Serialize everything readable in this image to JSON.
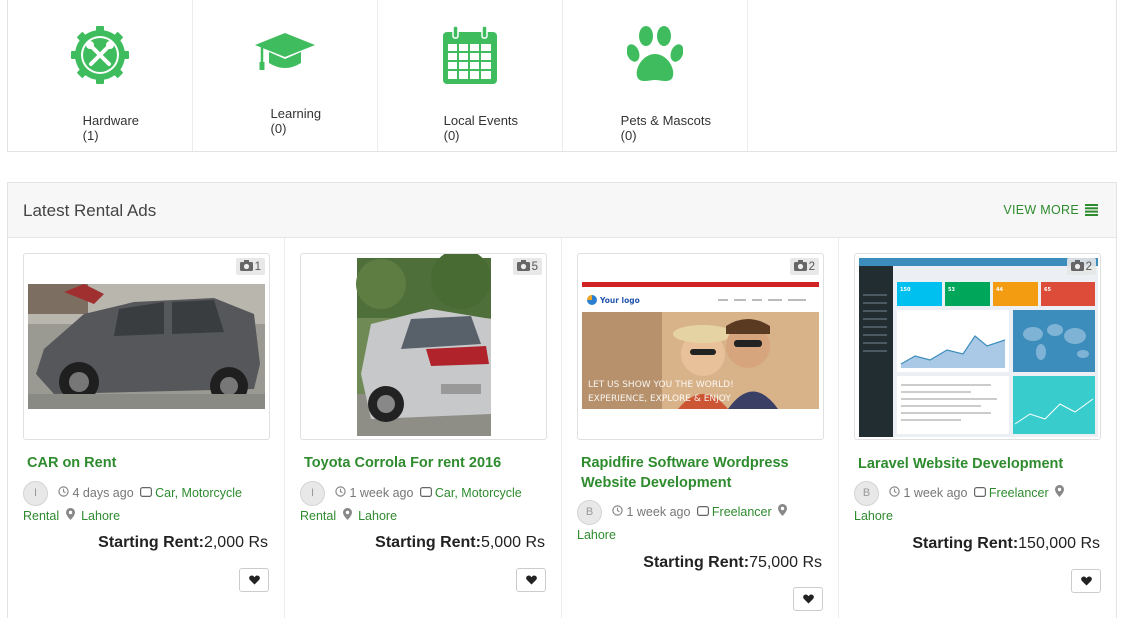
{
  "categories": [
    {
      "label": "Hardware",
      "count": "(1)",
      "icon": "gear-tools-icon",
      "color": "#3fbd5e"
    },
    {
      "label": "Learning",
      "count": "(0)",
      "icon": "graduation-cap-icon",
      "color": "#3fbd5e"
    },
    {
      "label": "Local Events",
      "count": "(0)",
      "icon": "calendar-icon",
      "color": "#3fbd5e"
    },
    {
      "label": "Pets & Mascots",
      "count": "(0)",
      "icon": "paw-icon",
      "color": "#3fbd5e"
    }
  ],
  "rental": {
    "title": "Latest Rental Ads",
    "view_more": "VIEW MORE"
  },
  "ads": [
    {
      "photo_count": "1",
      "title": "CAR on Rent",
      "avatar": "I",
      "time": "4 days ago",
      "category": "Car, Motorcycle",
      "category_tail": "Rental",
      "location": "Lahore",
      "rent_label": "Starting Rent:",
      "rent_value": "2,000 Rs"
    },
    {
      "photo_count": "5",
      "title": "Toyota Corrola For rent 2016",
      "avatar": "I",
      "time": "1 week ago",
      "category": "Car, Motorcycle",
      "category_tail": "Rental",
      "location": "Lahore",
      "rent_label": "Starting Rent:",
      "rent_value": "5,000 Rs"
    },
    {
      "photo_count": "2",
      "title": "Rapidfire Software Wordpress Website Development",
      "avatar": "B",
      "time": "1 week ago",
      "category": "Freelancer",
      "location": "Lahore",
      "rent_label": "Starting Rent:",
      "rent_value": "75,000 Rs",
      "image_text": {
        "logo": "Your logo",
        "line1": "LET US SHOW YOU THE WORLD!",
        "line2": "EXPERIENCE, EXPLORE & ENJOY"
      }
    },
    {
      "photo_count": "2",
      "title": "Laravel Website Development",
      "avatar": "B",
      "time": "1 week ago",
      "category": "Freelancer",
      "location": "Lahore",
      "rent_label": "Starting Rent:",
      "rent_value": "150,000 Rs",
      "image_text": {
        "s1": "150",
        "s2": "53",
        "s3": "44",
        "s4": "65"
      }
    }
  ]
}
